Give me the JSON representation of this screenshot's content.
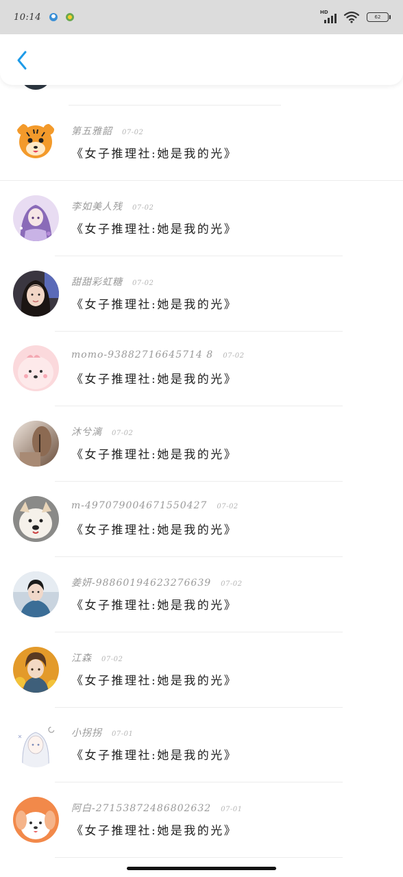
{
  "status_bar": {
    "time": "10:14",
    "network": "HD",
    "battery": "62"
  },
  "header": {
    "back_icon": "chevron-left-icon",
    "accent": "#1e9be8"
  },
  "items": [
    {
      "name": "第五雅韶",
      "date": "07-02",
      "book": "《女子推理社:她是我的光》"
    },
    {
      "name": "李如美人残",
      "date": "07-02",
      "book": "《女子推理社:她是我的光》"
    },
    {
      "name": "甜甜彩虹糖",
      "date": "07-02",
      "book": "《女子推理社:她是我的光》"
    },
    {
      "name": "momo-93882716645714 8",
      "date": "07-02",
      "book": "《女子推理社:她是我的光》"
    },
    {
      "name": "沐兮漓",
      "date": "07-02",
      "book": "《女子推理社:她是我的光》"
    },
    {
      "name": "m-497079004671550427",
      "date": "07-02",
      "book": "《女子推理社:她是我的光》"
    },
    {
      "name": "姜妍-98860194623276639",
      "date": "07-02",
      "book": "《女子推理社:她是我的光》"
    },
    {
      "name": "江森",
      "date": "07-02",
      "book": "《女子推理社:她是我的光》"
    },
    {
      "name": "小拐拐",
      "date": "07-01",
      "book": "《女子推理社:她是我的光》"
    },
    {
      "name": "阿白-27153872486802632",
      "date": "07-01",
      "book": "《女子推理社:她是我的光》"
    }
  ]
}
